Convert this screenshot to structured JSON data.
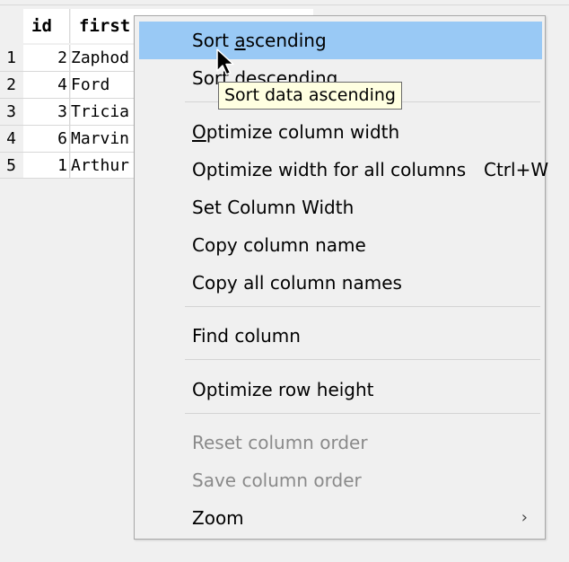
{
  "grid": {
    "headers": {
      "id": "id",
      "first": "first"
    },
    "rows": [
      {
        "num": "1",
        "id": "2",
        "first": "Zaphod"
      },
      {
        "num": "2",
        "id": "4",
        "first": "Ford"
      },
      {
        "num": "3",
        "id": "3",
        "first": "Tricia"
      },
      {
        "num": "4",
        "id": "6",
        "first": "Marvin"
      },
      {
        "num": "5",
        "id": "1",
        "first": "Arthur"
      }
    ]
  },
  "menu": {
    "sort_asc_pre": "Sort ",
    "sort_asc_ul": "a",
    "sort_asc_post": "scending",
    "sort_desc": "Sort descending",
    "optimize_width_ul": "O",
    "optimize_width_post": "ptimize column width",
    "optimize_all": "Optimize width for all columns",
    "optimize_all_shortcut": "Ctrl+W",
    "set_width": "Set Column Width",
    "copy_name": "Copy column name",
    "copy_all_names": "Copy all column names",
    "find_column": "Find column",
    "optimize_row_height": "Optimize row height",
    "reset_order": "Reset column order",
    "save_order": "Save column order",
    "zoom": "Zoom",
    "zoom_arrow": "›"
  },
  "tooltip": {
    "text": "Sort data ascending"
  },
  "colors": {
    "highlight": "#99c9f5",
    "tooltip_bg": "#ffffe1",
    "disabled_text": "#8a8a8a"
  }
}
